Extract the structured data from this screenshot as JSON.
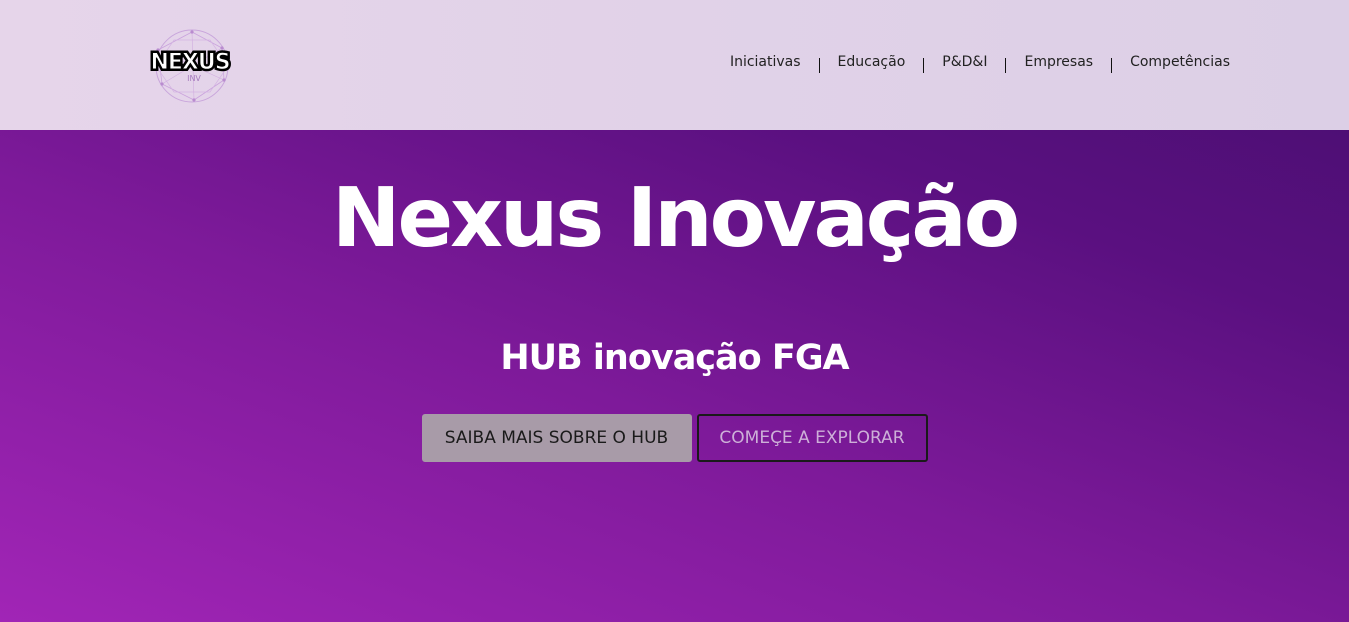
{
  "header": {
    "logo_text": "NEXUS",
    "logo_subtext": "INV",
    "nav": [
      {
        "label": "Iniciativas"
      },
      {
        "label": "Educação"
      },
      {
        "label": "P&D&I"
      },
      {
        "label": "Empresas"
      },
      {
        "label": "Competências"
      }
    ]
  },
  "hero": {
    "title": "Nexus Inovação",
    "subtitle": "HUB inovação FGA",
    "primary_button": "SAIBA MAIS SOBRE O HUB",
    "secondary_button": "COMEÇE A EXPLORAR"
  },
  "colors": {
    "header_bg": "#e3d4e9",
    "hero_gradient_start": "#a125b6",
    "hero_gradient_end": "#4e0f75",
    "primary_button_bg": "#a89ba8",
    "outline_button_text": "#cdb0d8"
  }
}
